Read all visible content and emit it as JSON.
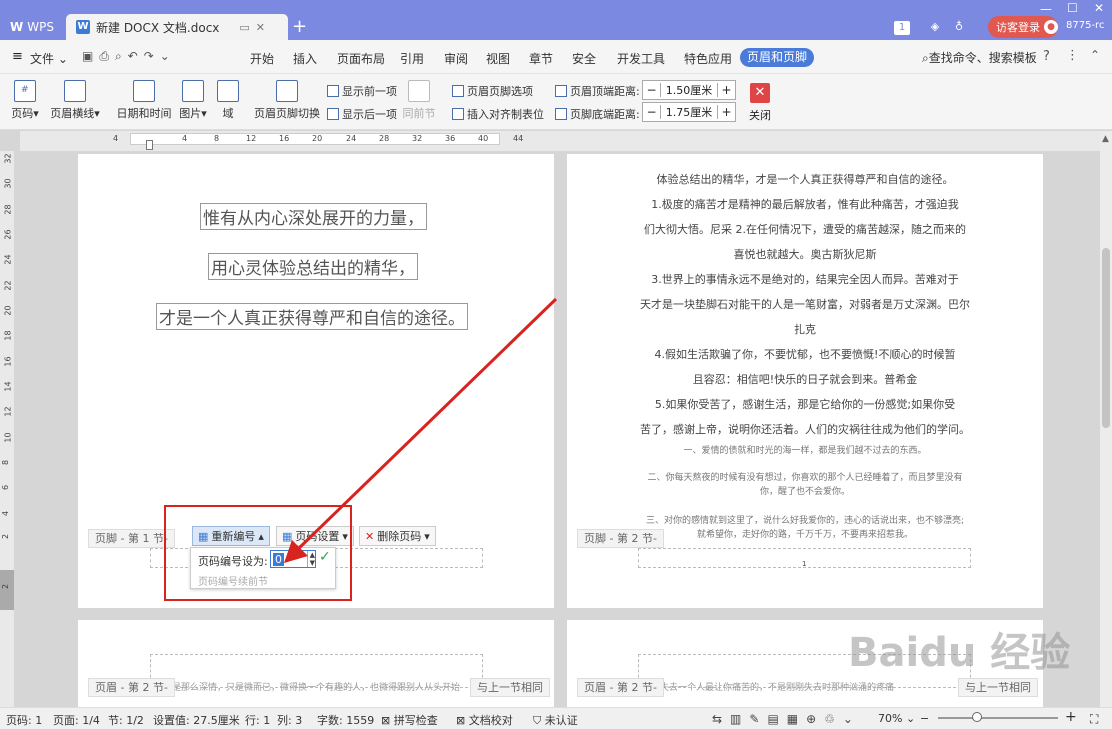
{
  "titlebar": {
    "app": "WPS",
    "doc_tab": "新建 DOCX 文档.docx",
    "login": "访客登录",
    "user_id": "8775-rc",
    "badge": "1"
  },
  "menu": {
    "file": "文件",
    "items": [
      "开始",
      "插入",
      "页面布局",
      "引用",
      "审阅",
      "视图",
      "章节",
      "安全",
      "开发工具",
      "特色应用"
    ],
    "active": "页眉和页脚",
    "search": "查找命令、搜索模板"
  },
  "ribbon": {
    "page_num": "页码",
    "header_line": "页眉横线",
    "date_time": "日期和时间",
    "picture": "图片",
    "field": "域",
    "switch": "页眉页脚切换",
    "show_prev": "显示前一项",
    "show_next": "显示后一项",
    "same_prev": "同前节",
    "hf_options": "页眉页脚选项",
    "insert_tab": "插入对齐制表位",
    "header_top_label": "页眉顶端距离:",
    "header_top_value": "1.50厘米",
    "footer_bottom_label": "页脚底端距离:",
    "footer_bottom_value": "1.75厘米",
    "close": "关闭"
  },
  "ruler": {
    "h": [
      "4",
      "4",
      "8",
      "12",
      "16",
      "20",
      "24",
      "28",
      "32",
      "36",
      "40",
      "44"
    ],
    "v": [
      "32",
      "30",
      "28",
      "26",
      "24",
      "22",
      "20",
      "18",
      "16",
      "14",
      "12",
      "10",
      "8",
      "6",
      "4",
      "2",
      "2"
    ]
  },
  "page1": {
    "lines": [
      "惟有从内心深处展开的力量，",
      "用心灵体验总结出的精华，",
      "才是一个人真正获得尊严和自信的途径。"
    ],
    "footer_label": "页脚 - 第 1 节-",
    "renumber": "重新编号",
    "page_settings": "页码设置",
    "delete_page_num": "删除页码",
    "popup_label": "页码编号设为:",
    "popup_value": "0",
    "popup_continue": "页码编号续前节"
  },
  "page2": {
    "lines": [
      "体验总结出的精华，才是一个人真正获得尊严和自信的途径。",
      "1.极度的痛苦才是精神的最后解放者，惟有此种痛苦，才强迫我",
      "们大彻大悟。尼采 2.在任何情况下，遭受的痛苦越深，随之而来的",
      "喜悦也就越大。奥古斯狄尼斯",
      "3.世界上的事情永远不是绝对的，结果完全因人而异。苦难对于",
      "天才是一块垫脚石对能干的人是一笔财富，对弱者是万丈深渊。巴尔",
      "扎克",
      "4.假如生活欺骗了你，不要忧郁，也不要愤慨!不顺心的时候暂",
      "且容忍：相信吧!快乐的日子就会到来。普希金",
      "5.如果你受苦了，感谢生活，那是它给你的一份感觉;如果你受",
      "苦了，感谢上帝，说明你还活着。人们的灾祸往往成为他们的学问。"
    ],
    "faint": [
      "一、爱情的债就和时光的海一样，都是我们越不过去的东西。",
      "二、你每天熬夜的时候有没有想过，你喜欢的那个人已经睡着了，而且梦里没有",
      "你，醒了也不会爱你。",
      "三、对你的感情就到这里了，说什么好我爱你的，违心的话说出来，也不够漂亮;",
      "就希望你，走好你的路，千万千万，不要再来招惹我。"
    ],
    "footer_label": "页脚 - 第 2 节-",
    "footer_num": "1"
  },
  "page3": {
    "header_label": "页眉 - 第 2 节-",
    "link_prev": "与上一节相同",
    "snippet": "是那么深情，只是微而已，微得换一个有趣的人，也微得跟别人从头开始"
  },
  "page4": {
    "header_label": "页眉 - 第 2 节-",
    "link_prev": "与上一节相同",
    "snippet": "失去一个人最让你痛苦的，不是刚刚失去时那种汹涌的疼痛"
  },
  "status": {
    "page": "页码: 1",
    "pages": "页面: 1/4",
    "section": "节: 1/2",
    "setting": "设置值: 27.5厘米",
    "row": "行: 1",
    "col": "列: 3",
    "words": "字数: 1559",
    "spell": "拼写检查",
    "proof": "文档校对",
    "cert": "未认证",
    "zoom": "70%"
  },
  "watermark": "Baidu 经验",
  "colors": {
    "title": "#7b89e0",
    "accent": "#4a7bd8",
    "annotation": "#d8231f"
  }
}
